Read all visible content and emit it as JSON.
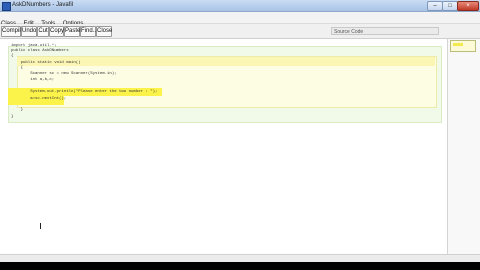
{
  "window": {
    "title": "AskDNumbers - Javafil",
    "controls": {
      "minimize": "–",
      "maximize": "□",
      "close": "×"
    }
  },
  "menu": [
    "Class",
    "Edit",
    "Tools",
    "Options"
  ],
  "toolbar": {
    "buttons": [
      "Compile",
      "Undo",
      "Cut",
      "Copy",
      "Paste",
      "Find...",
      "Close"
    ],
    "view_label": "Source Code"
  },
  "code_lines": [
    "import java.util.*;",
    "public class AskDNumbers",
    "{",
    "    public static void main()",
    "    {",
    "        Scanner sc = new Scanner(System.in);",
    "        int a,b,c;",
    "",
    "        System.out.println(\"Please enter the two number : \");",
    "        a=sc.nextInt();",
    "    }",
    "}"
  ]
}
